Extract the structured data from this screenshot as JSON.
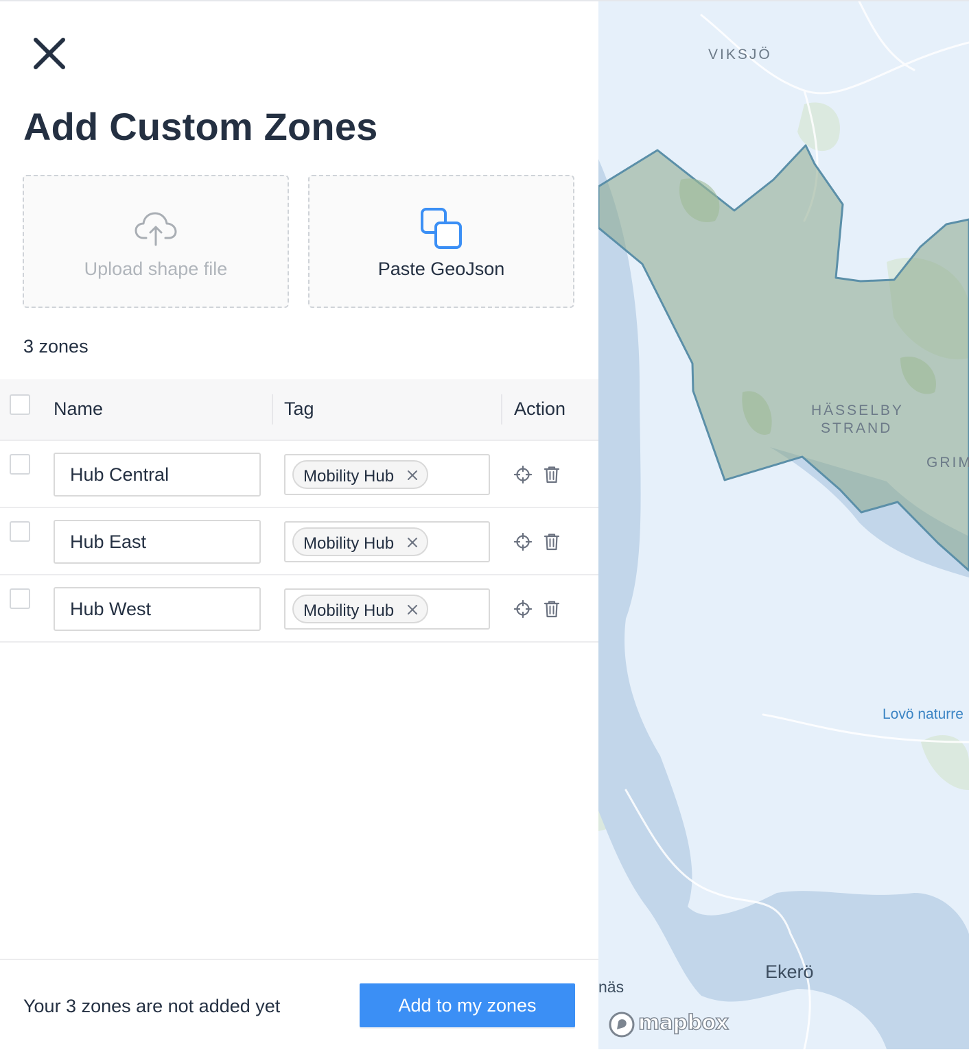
{
  "dialog": {
    "title": "Add Custom Zones",
    "close_icon": "close-icon"
  },
  "import": {
    "upload_label": "Upload shape file",
    "upload_icon": "cloud-upload-icon",
    "paste_label": "Paste GeoJson",
    "paste_icon": "copy-squares-icon"
  },
  "summary": {
    "zone_count": "3 zones"
  },
  "table": {
    "headers": {
      "name": "Name",
      "tag": "Tag",
      "action": "Action"
    },
    "rows": [
      {
        "name": "Hub Central",
        "tag": "Mobility Hub",
        "checked": false
      },
      {
        "name": "Hub East",
        "tag": "Mobility Hub",
        "checked": false
      },
      {
        "name": "Hub West",
        "tag": "Mobility Hub",
        "checked": false
      }
    ],
    "action_icons": [
      "crosshair-icon",
      "trash-icon"
    ]
  },
  "footer": {
    "note": "Your 3 zones are not added yet",
    "primary_button": "Add to my zones"
  },
  "map": {
    "labels": {
      "viksjo": "VIKSJÖ",
      "hasselby_line1": "HÄSSELBY",
      "hasselby_line2": "STRAND",
      "grim": "GRIM",
      "lovo": "Lovö naturre",
      "ekero": "Ekerö",
      "nas": "näs"
    },
    "attribution": "mapbox"
  },
  "colors": {
    "accent": "#3b8ff5",
    "text": "#243042",
    "zone_fill": "#8aa88a",
    "zone_stroke": "#5b8fa8",
    "water": "#c2d6ea",
    "land": "#e6f0fa"
  }
}
